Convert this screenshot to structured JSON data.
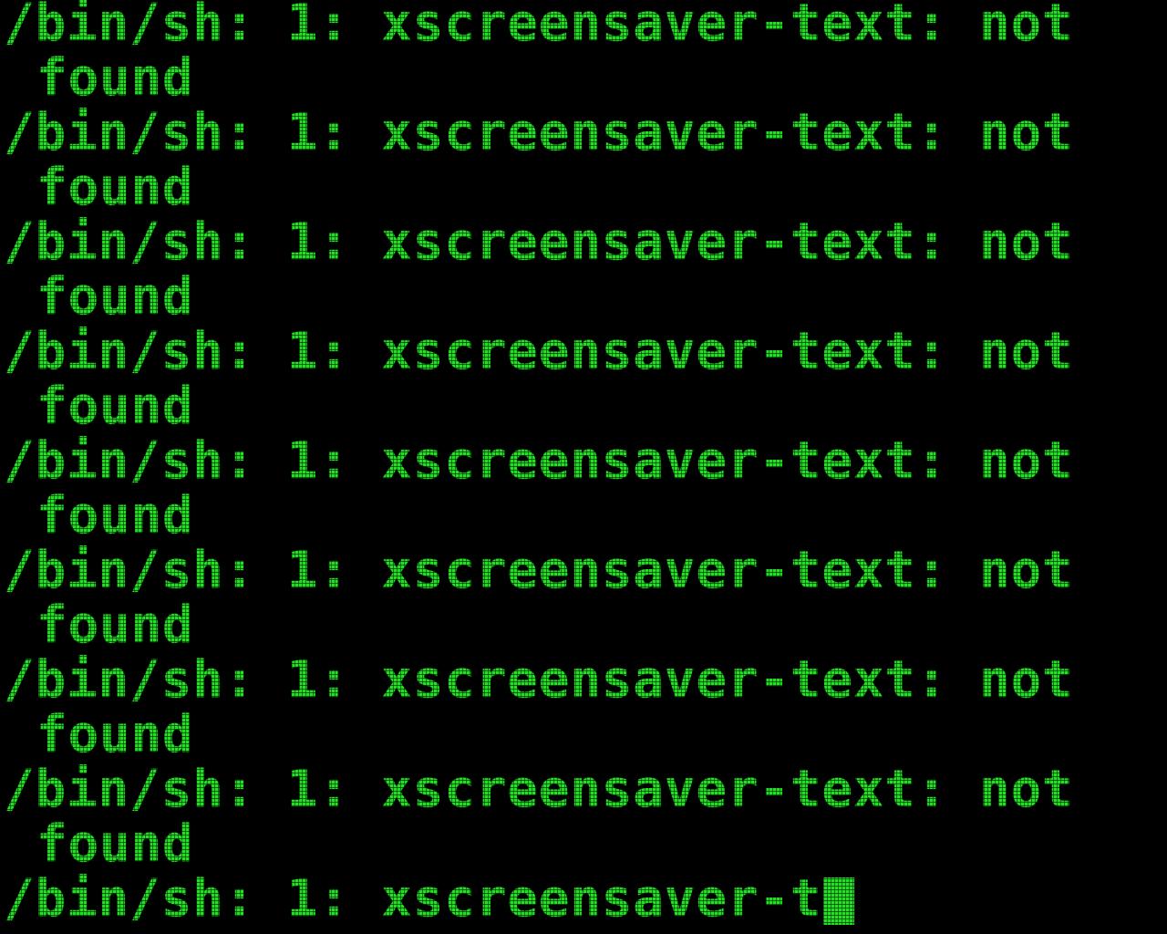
{
  "terminal": {
    "lines": [
      {
        "text": "/bin/sh: 1: xscreensaver-text: not",
        "continuation": false
      },
      {
        "text": "found",
        "continuation": true
      },
      {
        "text": "/bin/sh: 1: xscreensaver-text: not",
        "continuation": false
      },
      {
        "text": "found",
        "continuation": true
      },
      {
        "text": "/bin/sh: 1: xscreensaver-text: not",
        "continuation": false
      },
      {
        "text": "found",
        "continuation": true
      },
      {
        "text": "/bin/sh: 1: xscreensaver-text: not",
        "continuation": false
      },
      {
        "text": "found",
        "continuation": true
      },
      {
        "text": "/bin/sh: 1: xscreensaver-text: not",
        "continuation": false
      },
      {
        "text": "found",
        "continuation": true
      },
      {
        "text": "/bin/sh: 1: xscreensaver-text: not",
        "continuation": false
      },
      {
        "text": "found",
        "continuation": true
      },
      {
        "text": "/bin/sh: 1: xscreensaver-text: not",
        "continuation": false
      },
      {
        "text": "found",
        "continuation": true
      },
      {
        "text": "/bin/sh: 1: xscreensaver-text: not",
        "continuation": false
      },
      {
        "text": "found",
        "continuation": true
      }
    ],
    "current_line": "/bin/sh: 1: xscreensaver-t",
    "colors": {
      "background": "#000000",
      "text": "#22e022"
    }
  }
}
